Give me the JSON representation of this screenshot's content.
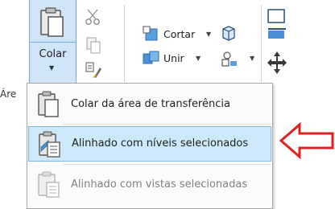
{
  "ribbon": {
    "paste_label": "Colar",
    "cut_label": "Cortar",
    "join_label": "Unir",
    "panel_label": "Áre"
  },
  "paste_menu": {
    "items": [
      {
        "label": "Colar da área de transferência",
        "icon": "clipboard-icon",
        "state": "normal"
      },
      {
        "label": "Alinhado com níveis selecionados",
        "icon": "aligned-levels-paste-icon",
        "state": "highlighted"
      },
      {
        "label": "Alinhado com vistas selecionadas",
        "icon": "aligned-views-paste-icon",
        "state": "disabled"
      }
    ]
  },
  "annotation": {
    "arrow_icon": "left-arrow-outline-icon",
    "color": "#e02020"
  },
  "colors": {
    "accent": "#cde8fa",
    "accent_border": "#7ab8e6",
    "brand_blue": "#3b82c4"
  }
}
